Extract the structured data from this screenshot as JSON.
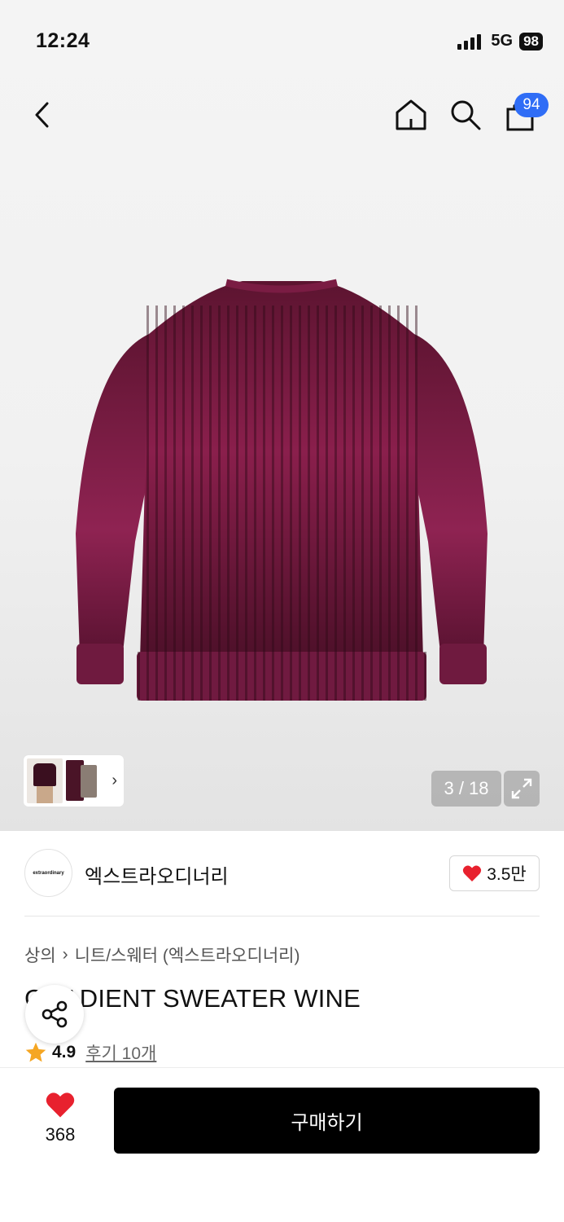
{
  "status_bar": {
    "time": "12:24",
    "network": "5G",
    "battery": "98"
  },
  "nav": {
    "cart_count": "94"
  },
  "gallery": {
    "counter": "3 / 18"
  },
  "brand": {
    "logo_text": "extraordinary",
    "name": "엑스트라오디너리",
    "likes": "3.5만"
  },
  "breadcrumb": {
    "category": "상의",
    "subcategory": "니트/스웨터 (엑스트라오디너리)"
  },
  "product": {
    "title": "GRADIENT SWEATER WINE",
    "rating": "4.9",
    "reviews": "후기 10개"
  },
  "bottom_bar": {
    "wish_count": "368",
    "buy_label": "구매하기"
  },
  "colors": {
    "accent_blue": "#2f6df6",
    "heart_red": "#e8212e",
    "star": "#f5a623",
    "sweater": "#6a1636"
  }
}
